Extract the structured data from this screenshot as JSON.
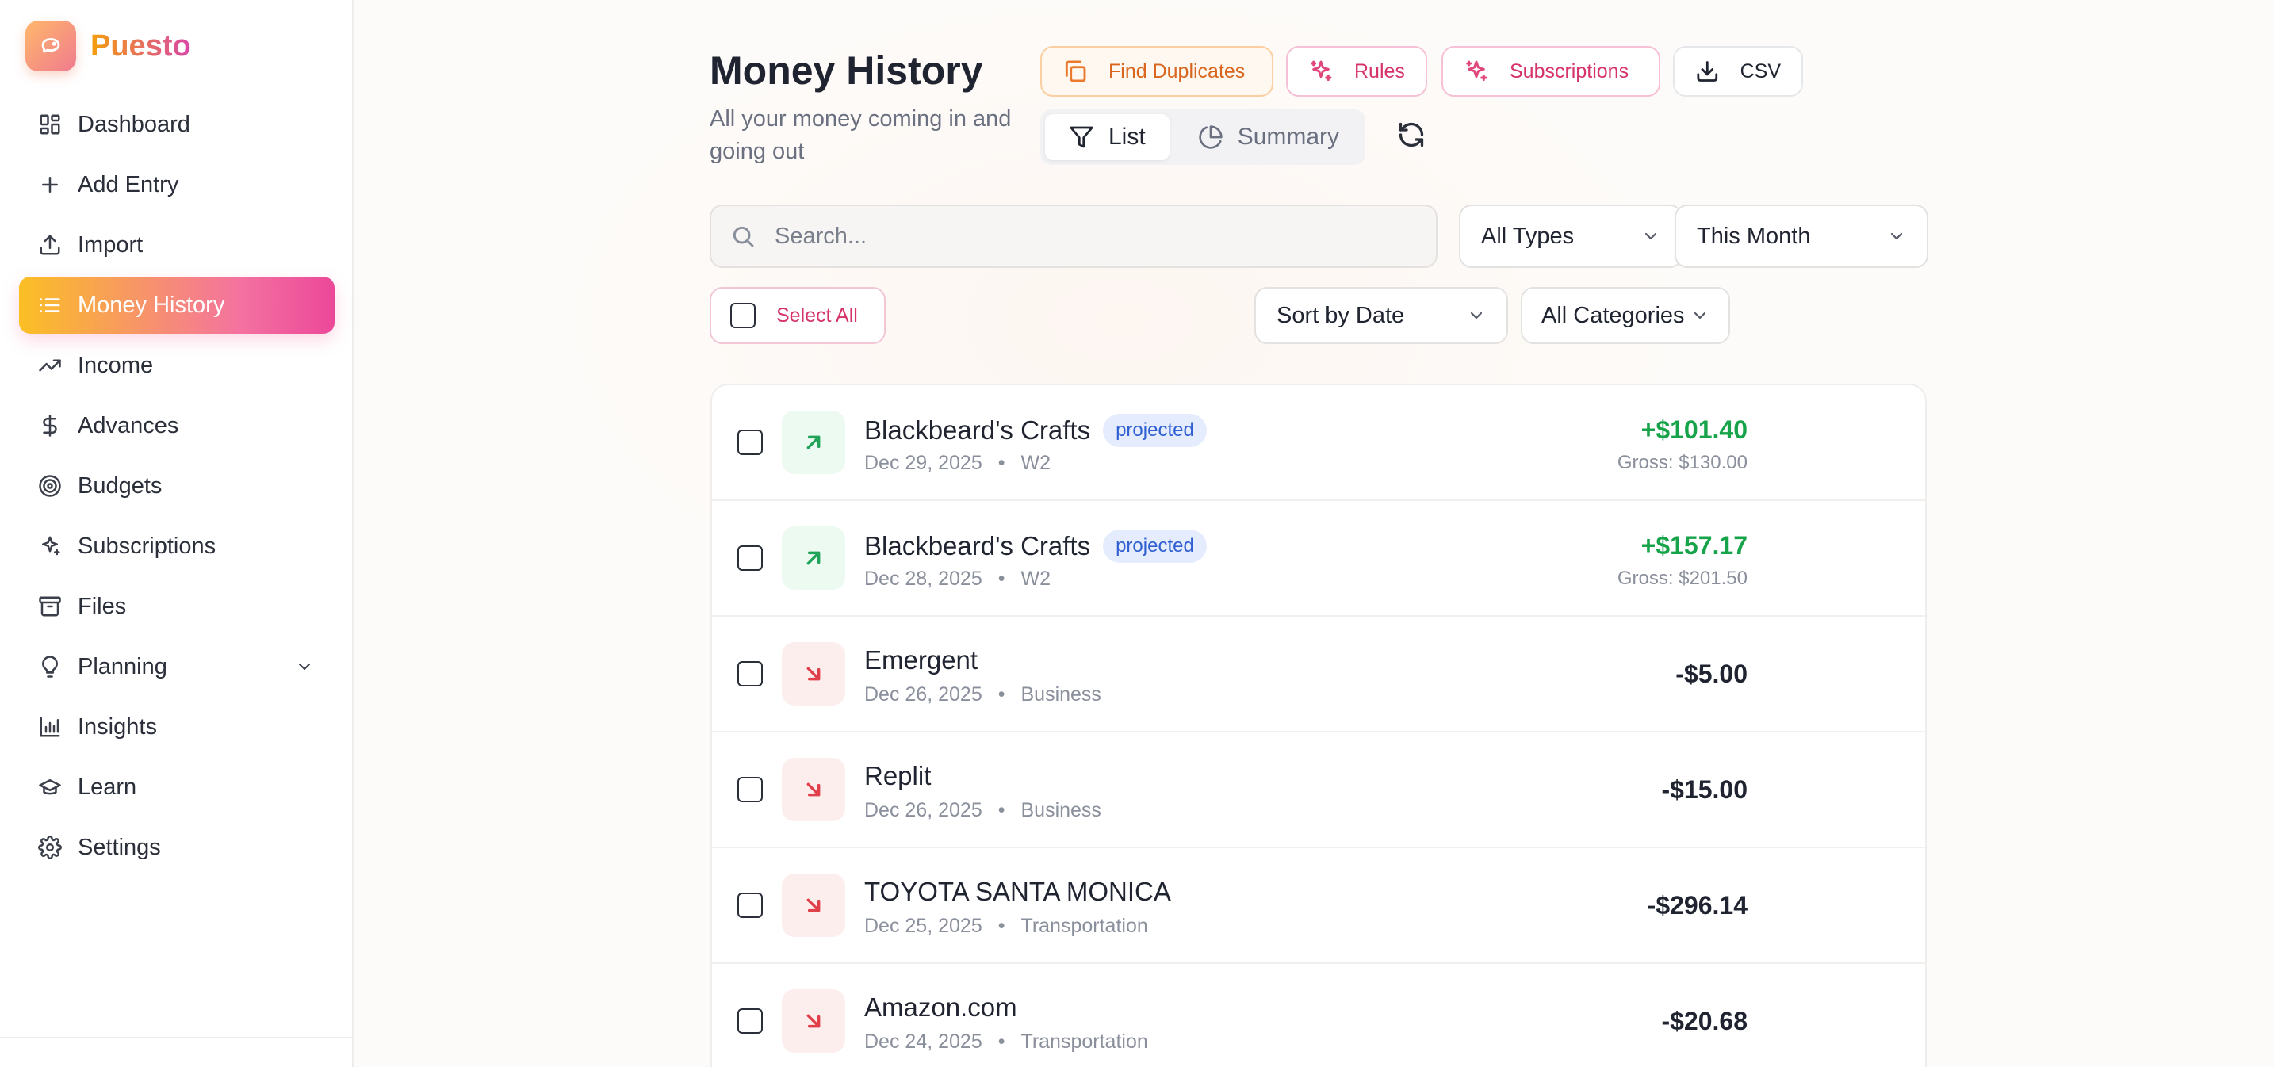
{
  "brand": {
    "name": "Puesto"
  },
  "sidebar": {
    "items": [
      {
        "label": "Dashboard",
        "icon": "grid-icon"
      },
      {
        "label": "Add Entry",
        "icon": "plus-icon"
      },
      {
        "label": "Import",
        "icon": "upload-icon"
      },
      {
        "label": "Money History",
        "icon": "list-icon",
        "active": true
      },
      {
        "label": "Income",
        "icon": "trending-up-icon"
      },
      {
        "label": "Advances",
        "icon": "dollar-icon"
      },
      {
        "label": "Budgets",
        "icon": "target-icon"
      },
      {
        "label": "Subscriptions",
        "icon": "sparkle-icon"
      },
      {
        "label": "Files",
        "icon": "archive-icon"
      },
      {
        "label": "Planning",
        "icon": "lightbulb-icon",
        "expandable": true
      },
      {
        "label": "Insights",
        "icon": "bar-chart-icon"
      },
      {
        "label": "Learn",
        "icon": "graduation-cap-icon"
      },
      {
        "label": "Settings",
        "icon": "gear-icon"
      }
    ]
  },
  "header": {
    "title": "Money History",
    "subtitle": "All your money coming in and going out",
    "buttons": {
      "find_duplicates": "Find Duplicates",
      "rules": "Rules",
      "subscriptions": "Subscriptions",
      "csv": "CSV"
    },
    "view_toggle": {
      "list": "List",
      "summary": "Summary",
      "selected": "List"
    }
  },
  "filters": {
    "search_placeholder": "Search...",
    "type": "All Types",
    "period": "This Month",
    "select_all": "Select All",
    "sort": "Sort by Date",
    "category": "All Categories"
  },
  "colors": {
    "accent_gradient_start": "#fbbf24",
    "accent_gradient_end": "#ec4899",
    "income": "#16a34a",
    "expense_icon": "#e0404a",
    "badge_projected": "#2f5fd0"
  },
  "transactions": [
    {
      "name": "Blackbeard's Crafts",
      "badge": "projected",
      "date": "Dec 29, 2025",
      "category": "W2",
      "direction": "in",
      "amount": "+$101.40",
      "gross": "Gross: $130.00"
    },
    {
      "name": "Blackbeard's Crafts",
      "badge": "projected",
      "date": "Dec 28, 2025",
      "category": "W2",
      "direction": "in",
      "amount": "+$157.17",
      "gross": "Gross: $201.50"
    },
    {
      "name": "Emergent",
      "date": "Dec 26, 2025",
      "category": "Business",
      "direction": "out",
      "amount": "-$5.00"
    },
    {
      "name": "Replit",
      "date": "Dec 26, 2025",
      "category": "Business",
      "direction": "out",
      "amount": "-$15.00"
    },
    {
      "name": "TOYOTA SANTA MONICA",
      "date": "Dec 25, 2025",
      "category": "Transportation",
      "direction": "out",
      "amount": "-$296.14"
    },
    {
      "name": "Amazon.com",
      "date": "Dec 24, 2025",
      "category": "Transportation",
      "direction": "out",
      "amount": "-$20.68"
    }
  ]
}
